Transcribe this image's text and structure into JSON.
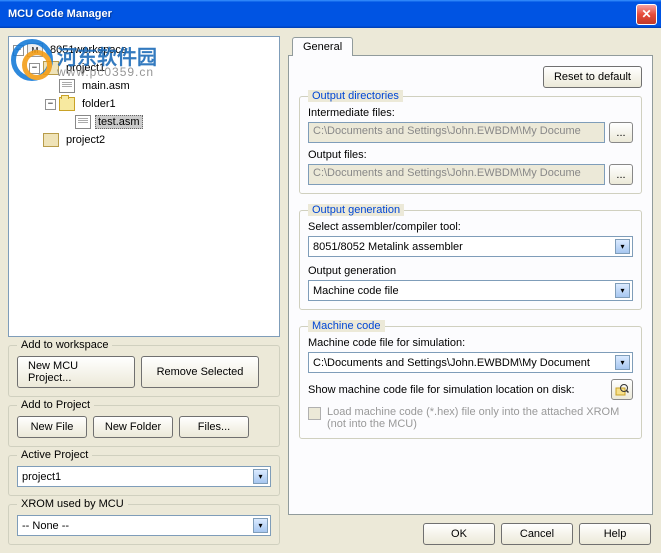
{
  "window": {
    "title": "MCU Code Manager"
  },
  "watermark": {
    "text1": "河东软件园",
    "text2": "www.pc0359.cn"
  },
  "tree": {
    "root": "8051workspace",
    "project1": "project1",
    "main_asm": "main.asm",
    "folder1": "folder1",
    "test_asm": "test.asm",
    "project2": "project2"
  },
  "left": {
    "add_workspace": {
      "legend": "Add to workspace",
      "new_mcu": "New MCU Project...",
      "remove": "Remove Selected"
    },
    "add_project": {
      "legend": "Add to Project",
      "new_file": "New File",
      "new_folder": "New Folder",
      "files": "Files..."
    },
    "active_project": {
      "legend": "Active Project",
      "value": "project1"
    },
    "xrom": {
      "legend": "XROM used by MCU",
      "value": "-- None --"
    }
  },
  "tabs": {
    "general": "General"
  },
  "general": {
    "reset": "Reset to default",
    "out_dirs": {
      "legend": "Output directories",
      "intermediate_label": "Intermediate files:",
      "intermediate_value": "C:\\Documents and Settings\\John.EWBDM\\My Docume",
      "output_label": "Output files:",
      "output_value": "C:\\Documents and Settings\\John.EWBDM\\My Docume",
      "dots": "..."
    },
    "out_gen": {
      "legend": "Output generation",
      "select_label": "Select assembler/compiler tool:",
      "select_value": "8051/8052 Metalink assembler",
      "outgen_label": "Output generation",
      "outgen_value": "Machine code file"
    },
    "mcode": {
      "legend": "Machine code",
      "file_label": "Machine code file for simulation:",
      "file_value": "C:\\Documents and Settings\\John.EWBDM\\My Document",
      "show_label": "Show machine code file for simulation location on disk:",
      "load_label": "Load machine code (*.hex) file only into the attached XROM (not into the MCU)"
    }
  },
  "footer": {
    "ok": "OK",
    "cancel": "Cancel",
    "help": "Help"
  }
}
